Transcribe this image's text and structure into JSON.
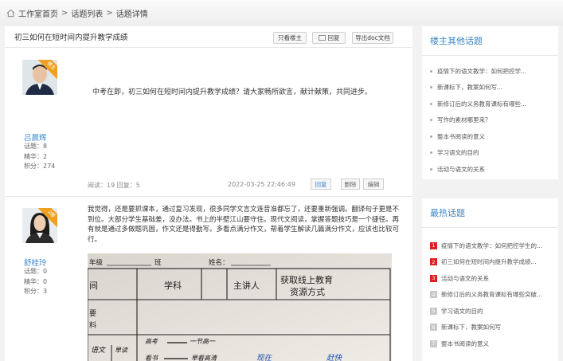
{
  "breadcrumb": {
    "home": "工作室首页",
    "separator": ">",
    "list": "话题列表",
    "current": "话题详情"
  },
  "topic": {
    "title": "初三如何在短时间内提升教学成绩",
    "buttons": {
      "only_author": "只看楼主",
      "reply": "回复",
      "export": "导出doc文档"
    }
  },
  "posts": [
    {
      "badge": "楼主",
      "user_name": "吕晨辉",
      "stats": [
        "话题：8",
        "精华：2",
        "积分：274"
      ],
      "text": "中考在即，初三如何在短时间内提升教学成绩？请大家畅所欲言，献计献策，共同进步。",
      "meta_stat": "阅读：19   回复：5",
      "meta_date": "2022-03-25 22:46:49",
      "actions": {
        "reply": "回复",
        "delete": "删除",
        "edit": "编辑"
      }
    },
    {
      "badge": "2楼",
      "user_name": "舒桂玲",
      "stats": [
        "话题：0",
        "精华：0",
        "积分：3"
      ],
      "text": "我觉得，还是要抓课本，通过复习发现，很多同学文言文连音准都忘了，还要重新强调。翻译句子更是不到位。大部分学生基础差，没办法。书上的半壁江山要守住。现代文阅读，掌握答题技巧是一个捷径。再有就是通过多做题巩固，作文还是得勤写。多看点满分作文，帮着学生解读几篇满分作文，应该也比较可行。",
      "photo": {
        "row1": [
          "年级",
          "班",
          "姓名："
        ],
        "headers": [
          "间",
          "学科",
          "主讲人",
          "获取线上教育",
          "资源方式"
        ],
        "side": [
          "要",
          "料"
        ],
        "handwriting": [
          "语文",
          "早读",
          "高考",
          "一节高一",
          "看书",
          "早看高清",
          "现在",
          "赶快"
        ]
      }
    }
  ],
  "sidebar": {
    "other_title": "楼主其他话题",
    "other_topics": [
      "疫情下的语文教学：如何把控学...",
      "新课标下，教案如何写...",
      "新修订后的义务教育课标有哪些...",
      "写作的素材哪里来？",
      "整本书阅读的意义",
      "学习语文的目的",
      "活动与语文的关系"
    ],
    "hot_title": "最热话题",
    "hot_topics": [
      {
        "rank": "1",
        "label": "疫情下的语文教学：如何把控学生的..."
      },
      {
        "rank": "2",
        "label": "初三如何在短时间内提升教学成绩..."
      },
      {
        "rank": "3",
        "label": "活动与语文的关系"
      },
      {
        "rank": "4",
        "label": "新修订后的义务教育课标有哪些突破..."
      },
      {
        "rank": "5",
        "label": "学习语文的目的"
      },
      {
        "rank": "6",
        "label": "新课标下，教案如何写"
      },
      {
        "rank": "7",
        "label": "整本书阅读的意义"
      }
    ]
  },
  "colors": {
    "accent": "#3a86c8",
    "hot_rank": "#e02020",
    "badge": "#f0a020"
  }
}
